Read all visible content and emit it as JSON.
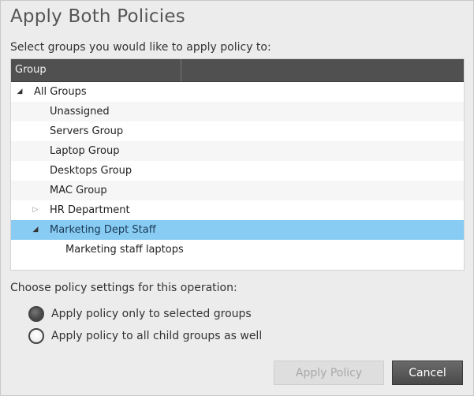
{
  "dialog": {
    "title": "Apply Both Policies",
    "prompt": "Select groups you would like to apply policy to:"
  },
  "tree": {
    "column_header": "Group",
    "rows": [
      {
        "label": "All Groups",
        "toggle": "expanded",
        "level": 0
      },
      {
        "label": "Unassigned",
        "toggle": "none",
        "level": 1
      },
      {
        "label": "Servers Group",
        "toggle": "none",
        "level": 1
      },
      {
        "label": "Laptop Group",
        "toggle": "none",
        "level": 1
      },
      {
        "label": "Desktops Group",
        "toggle": "none",
        "level": 1
      },
      {
        "label": "MAC Group",
        "toggle": "none",
        "level": 1
      },
      {
        "label": "HR Department",
        "toggle": "collapsed",
        "level": 1
      },
      {
        "label": "Marketing Dept Staff",
        "toggle": "expanded",
        "level": 1,
        "selected": true
      },
      {
        "label": "Marketing staff laptops",
        "toggle": "none",
        "level": 2
      }
    ]
  },
  "settings": {
    "prompt": "Choose policy settings for this operation:",
    "options": [
      {
        "label": "Apply policy only to selected groups",
        "checked": true
      },
      {
        "label": "Apply policy to all child groups as well",
        "checked": false
      }
    ]
  },
  "buttons": {
    "apply": "Apply Policy",
    "cancel": "Cancel"
  },
  "colors": {
    "selected_row": "#88ccf3",
    "header_bg": "#505050",
    "cancel_bg": "#4a4a4a"
  }
}
